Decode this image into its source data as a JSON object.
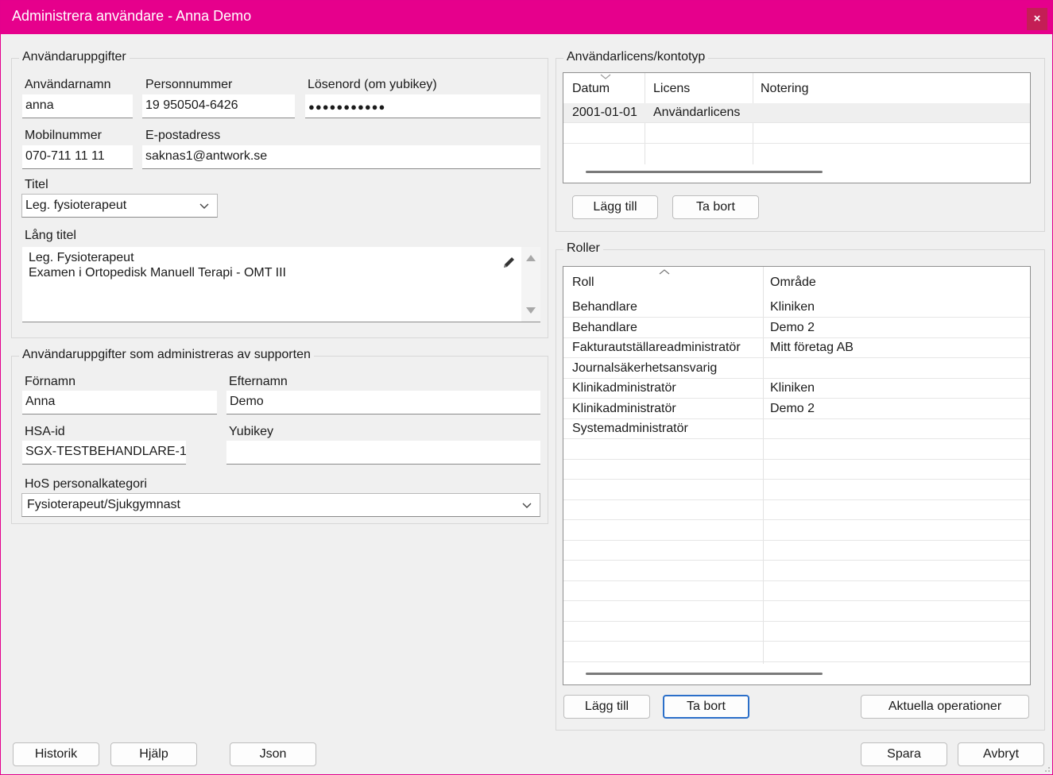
{
  "window": {
    "title": "Administrera användare - Anna Demo",
    "close_label": "×"
  },
  "user_details": {
    "legend": "Användaruppgifter",
    "username_label": "Användarnamn",
    "username": "anna",
    "ssn_label": "Personnummer",
    "ssn": "19 950504-6426",
    "password_label": "Lösenord (om yubikey)",
    "password": "●●●●●●●●●●●",
    "mobile_label": "Mobilnummer",
    "mobile": "070-711 11 11",
    "email_label": "E-postadress",
    "email": "saknas1@antwork.se",
    "title_label": "Titel",
    "title_value": "Leg. fysioterapeut",
    "long_title_label": "Lång titel",
    "long_title_lines": [
      "Leg. Fysioterapeut",
      "Examen i Ortopedisk Manuell Terapi - OMT III"
    ]
  },
  "support_details": {
    "legend": "Användaruppgifter som administreras av supporten",
    "firstname_label": "Förnamn",
    "firstname": "Anna",
    "lastname_label": "Efternamn",
    "lastname": "Demo",
    "hsa_label": "HSA-id",
    "hsa": "SGX-TESTBEHANDLARE-1",
    "yubikey_label": "Yubikey",
    "yubikey": "",
    "category_label": "HoS personalkategori",
    "category": "Fysioterapeut/Sjukgymnast"
  },
  "license": {
    "legend": "Användarlicens/kontotyp",
    "headers": [
      "Datum",
      "Licens",
      "Notering"
    ],
    "rows": [
      [
        "2001-01-01",
        "Användarlicens",
        ""
      ]
    ],
    "add_label": "Lägg till",
    "remove_label": "Ta bort"
  },
  "roles": {
    "legend": "Roller",
    "headers": [
      "Roll",
      "Område"
    ],
    "rows": [
      [
        "Behandlare",
        "Kliniken"
      ],
      [
        "Behandlare",
        "Demo 2"
      ],
      [
        "Fakturautställareadministratör",
        "Mitt företag AB"
      ],
      [
        "Journalsäkerhetsansvarig",
        ""
      ],
      [
        "Klinikadministratör",
        "Kliniken"
      ],
      [
        "Klinikadministratör",
        "Demo 2"
      ],
      [
        "Systemadministratör",
        ""
      ]
    ],
    "add_label": "Lägg till",
    "remove_label": "Ta bort",
    "operations_label": "Aktuella operationer"
  },
  "footer": {
    "history_label": "Historik",
    "help_label": "Hjälp",
    "json_label": "Json",
    "save_label": "Spara",
    "cancel_label": "Avbryt"
  }
}
